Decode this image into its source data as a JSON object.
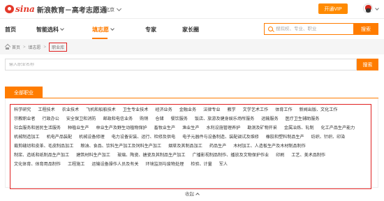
{
  "brand": {
    "sina": "sina",
    "text": "新浪教育－高考志愿通"
  },
  "city": "北京",
  "vip_button": "开通VIP",
  "nav": [
    {
      "label": "首页",
      "active": false,
      "dropdown": false
    },
    {
      "label": "智能选科",
      "active": false,
      "dropdown": true
    },
    {
      "label": "填志愿",
      "active": true,
      "dropdown": true
    },
    {
      "label": "专家",
      "active": false,
      "dropdown": false
    },
    {
      "label": "家长圈",
      "active": false,
      "dropdown": false
    }
  ],
  "search": {
    "placeholder": "搜院校、专业、职业",
    "button": "搜索"
  },
  "breadcrumb": [
    "首页",
    "填志愿",
    "职业库"
  ],
  "job_search": {
    "placeholder": "输入职业名称",
    "button": "搜索"
  },
  "tab": "全部职业",
  "jobs": [
    "科学研究",
    "工程技术",
    "农业技术",
    "飞机和船舶技术",
    "卫生专业技术",
    "经济业务",
    "金融业务",
    "法律专业",
    "教学",
    "文学艺术工作",
    "体育工作",
    "新闻出版、文化工作",
    "宗教职业者",
    "行政办公",
    "安全保卫和消防",
    "邮政和电信业务",
    "购销",
    "仓储",
    "餐饮服务",
    "饭店、旅游及健身娱乐场所服务",
    "运输服务",
    "医疗卫生辅助服务",
    "社会服务和居民生活服务",
    "种植业生产",
    "林业生产及野生动植物保护",
    "畜牧业生产",
    "渔业生产",
    "水利设施管理养护",
    "勘测及矿物开采",
    "金属冶炼、轧制",
    "化工产品生产能力",
    "机械制造加工",
    "机电产品装配",
    "机械设备修理",
    "电力设备安装、运行、检修及供电",
    "电子元器件与设备制造、装配调试及维修",
    "橡胶和塑料制品生产",
    "纺织、针织、印染",
    "裁剪缝纫和皮革、毛皮制品加工",
    "粮油、食品、饮料生产加工及饲料生产加工",
    "烟草及其制品加工",
    "药品生产",
    "木材加工、人造板生产及木材制品制作",
    "制浆、造纸和纸制品生产加工",
    "建筑材料生产加工",
    "玻璃、陶瓷、搪瓷及其制品生产加工",
    "广播影视制品制作、播放及文物保护作业",
    "印刷",
    "工艺、美术品制作",
    "文化体育、体育用品制作",
    "工程施工",
    "运输设备操作人员及有关",
    "环境监测与废物处理",
    "检验、计量",
    "军人"
  ],
  "collapse": "收起"
}
